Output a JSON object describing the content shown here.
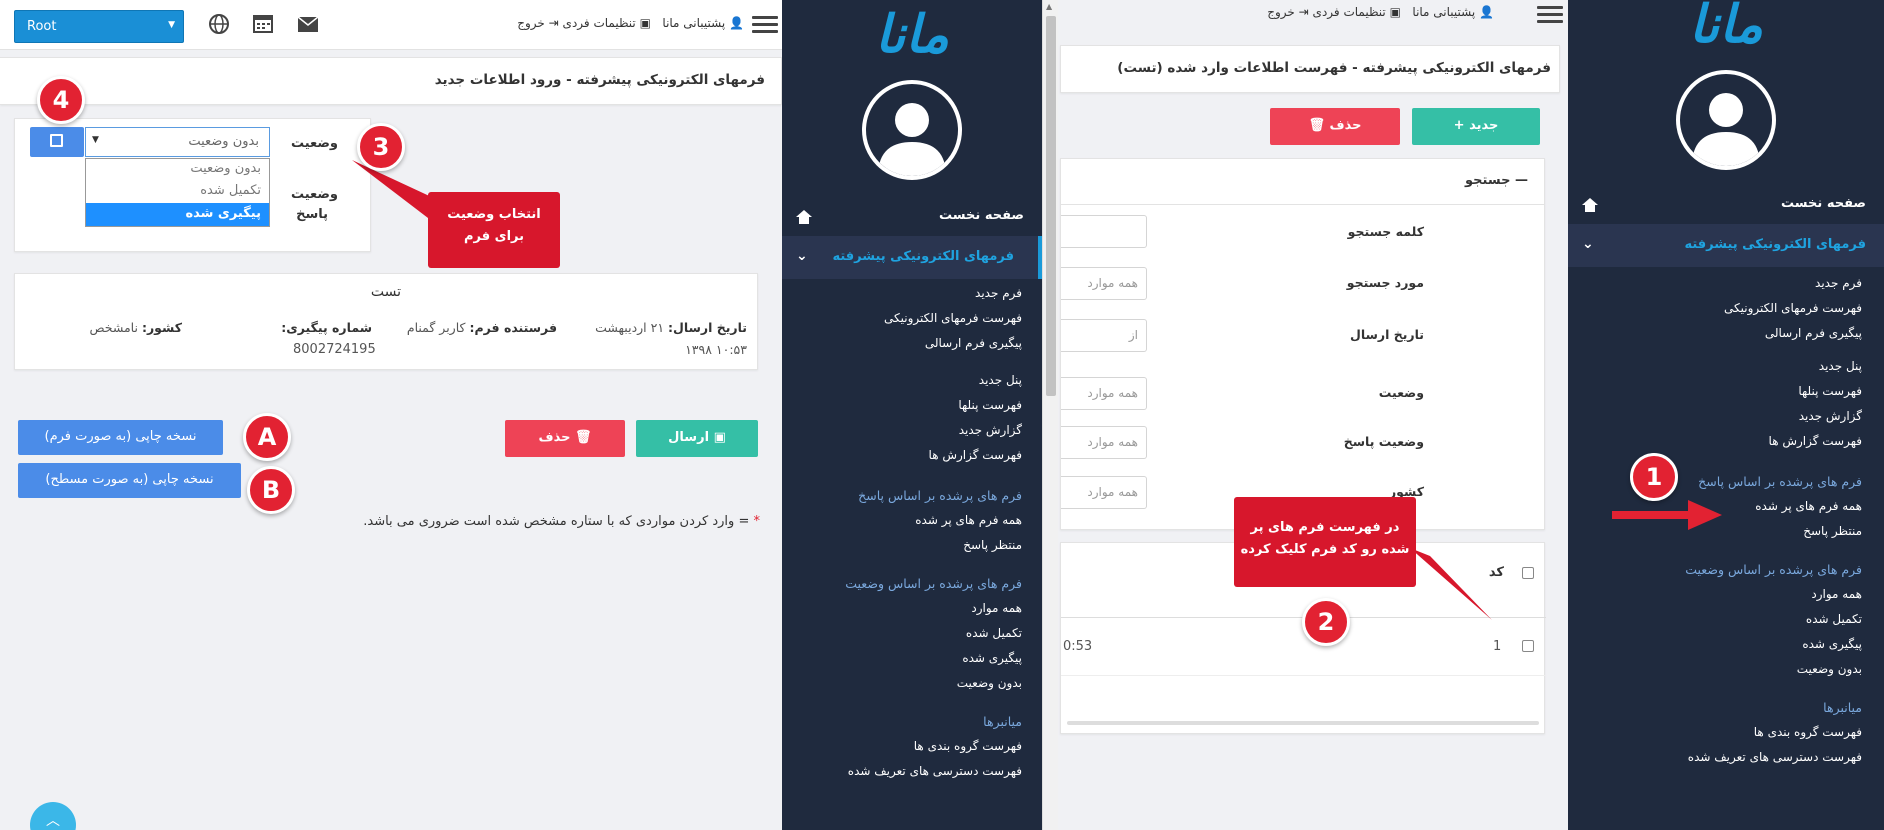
{
  "header": {
    "root_select": "Root",
    "support": "پشتیبانی مانا",
    "settings": "تنظیمات فردی",
    "logout": "خروج"
  },
  "logo": "مانا",
  "sidebar": {
    "home": "صفحه نخست",
    "active": "فرمهای الکترونیکی پیشرفته",
    "group1": [
      "فرم جدید",
      "فهرست فرمهای الکترونیکی",
      "پیگیری فرم ارسالی"
    ],
    "group2": [
      "پنل جدید",
      "فهرست پنلها",
      "گزارش جدید",
      "فهرست گزارش ها"
    ],
    "cat_by_answer": "فرم های پرشده بر اساس پاسخ",
    "group3": [
      "همه فرم های پر شده",
      "منتظر پاسخ"
    ],
    "cat_by_status": "فرم های پرشده بر اساس وضعیت",
    "group4": [
      "همه موارد",
      "تکمیل شده",
      "پیگیری شده",
      "بدون وضعیت"
    ],
    "cat_shortcuts": "میانبرها",
    "group5": [
      "فهرست گروه بندی ها",
      "فهرست دسترسی های تعریف شده"
    ]
  },
  "list_page": {
    "title": "فرمهای الکترونیکی پیشرفته - فهرست اطلاعات وارد شده (تست)",
    "new_btn": "جدید",
    "delete_btn": "حذف",
    "search_header": "جستجو",
    "labels": [
      "کلمه جستجو",
      "مورد جستجو",
      "تاریخ ارسال",
      "وضعیت",
      "وضعیت پاسخ",
      "کشور"
    ],
    "field_values": [
      "",
      "همه موارد",
      "از",
      "همه موارد",
      "همه موارد",
      "همه موارد"
    ],
    "col_code": "کد",
    "row_code": "1",
    "row_time": "0:53"
  },
  "form_page": {
    "title": "فرمهای الکترونیکی پیشرفته - ورود اطلاعات جدید",
    "status_label": "وضعیت",
    "status_value": "بدون وضعیت",
    "status_options": [
      "بدون وضعیت",
      "تکمیل شده",
      "پیگیری شده"
    ],
    "answer_label_1": "وضعیت",
    "answer_label_2": "پاسخ",
    "info_title": "تست",
    "send_date_label": "تاریخ ارسال:",
    "send_date_value": "۲۱ اردیبهشت",
    "send_time_value": "۱۰:۵۳ ۱۳۹۸",
    "sender_label": "فرستنده فرم:",
    "sender_value": "کاربر گمنام",
    "tracking_label": "شماره پیگیری:",
    "tracking_value": "8002724195",
    "country_label": "کشور:",
    "country_value": "نامشخص",
    "send_btn": "ارسال",
    "delete_btn": "حذف",
    "print_form_btn": "نسخه چاپی (به صورت فرم)",
    "print_flat_btn": "نسخه چاپی (به صورت مسطح)",
    "required_note_star": "*",
    "required_note": "= وارد کردن مواردی که با ستاره مشخص شده است ضروری می باشد."
  },
  "annotations": {
    "b1": "1",
    "b2": "2",
    "b3": "3",
    "b4": "4",
    "bA": "A",
    "bB": "B",
    "callout2_line1": "در فهرست فرم های پر",
    "callout2_line2": "شده رو کد فرم کلیک کرده",
    "callout3_line1": "انتخاب وضعیت",
    "callout3_line2": "برای فرم"
  },
  "colors": {
    "accent": "#1a9ad9",
    "sidebar": "#1f2a3e",
    "callout": "#d7172c",
    "teal": "#35bfa6",
    "red": "#ee4356",
    "blue": "#4b8ce8"
  }
}
